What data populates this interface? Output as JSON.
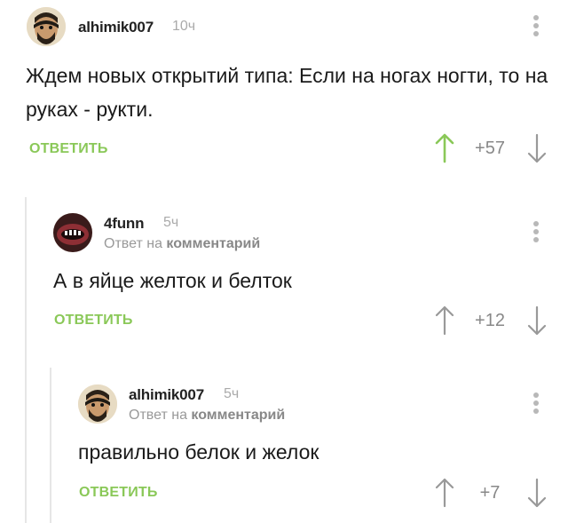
{
  "comments": [
    {
      "author": "alhimik007",
      "time": "10ч",
      "reply_prefix": "",
      "reply_target": "",
      "text": "Ждем новых открытий типа: Если на ногах ногти, то на руках - рукти.",
      "reply_label": "ОТВЕТИТЬ",
      "rating": "+57",
      "upvoted": true
    },
    {
      "author": "4funn",
      "time": "5ч",
      "reply_prefix": "Ответ на",
      "reply_target": "комментарий",
      "text": "А в яйце желток и белток",
      "reply_label": "ОТВЕТИТЬ",
      "rating": "+12",
      "upvoted": false
    },
    {
      "author": "alhimik007",
      "time": "5ч",
      "reply_prefix": "Ответ на",
      "reply_target": "комментарий",
      "text": "правильно белок и желок",
      "reply_label": "ОТВЕТИТЬ",
      "rating": "+7",
      "upvoted": false
    }
  ],
  "colors": {
    "accent_green": "#8ac858",
    "upvote_active": "#8ac858",
    "vote_inactive": "#999999",
    "meta_gray": "#999999"
  },
  "icons": {
    "more": "more-vertical-icon",
    "up": "arrow-up-icon",
    "down": "arrow-down-icon"
  }
}
